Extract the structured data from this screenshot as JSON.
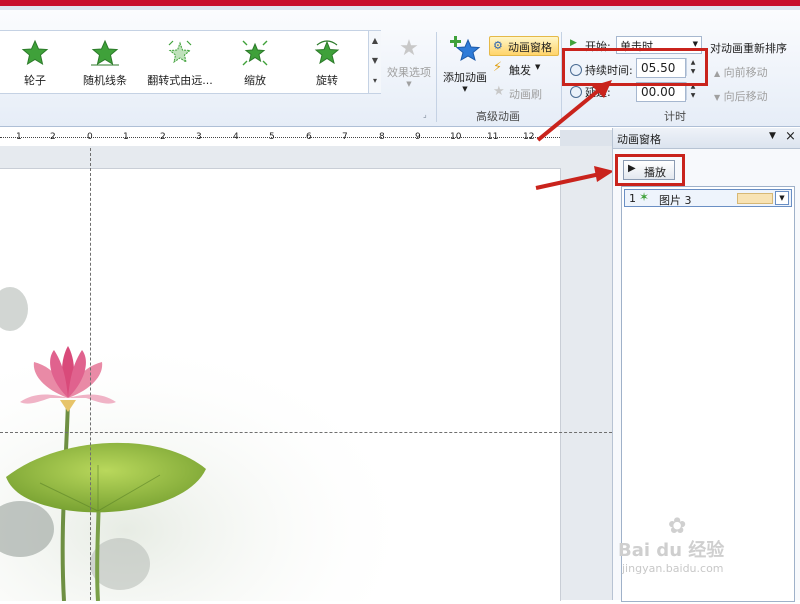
{
  "ribbon": {
    "animations": [
      {
        "label": "轮子",
        "icon": "star-wheel-icon"
      },
      {
        "label": "随机线条",
        "icon": "star-random-lines-icon"
      },
      {
        "label": "翻转式由远...",
        "icon": "star-flip-icon"
      },
      {
        "label": "缩放",
        "icon": "star-zoom-icon"
      },
      {
        "label": "旋转",
        "icon": "star-rotate-icon"
      }
    ],
    "effect_options_label": "效果选项",
    "add_animation_label": "添加动画",
    "animation_pane_btn": "动画窗格",
    "trigger_label": "触发",
    "animation_painter_label": "动画刷",
    "advanced_group_label": "高级动画",
    "start_label": "开始:",
    "start_value": "单击时",
    "duration_label": "持续时间:",
    "duration_value": "05.50",
    "delay_label": "延迟:",
    "delay_value": "00.00",
    "timing_group_label": "计时",
    "reorder_title": "对动画重新排序",
    "move_earlier_label": "向前移动",
    "move_later_label": "向后移动"
  },
  "ruler": {
    "labels": [
      "1",
      "2",
      "1",
      "0",
      "1",
      "2",
      "3",
      "4",
      "5",
      "6",
      "7",
      "8",
      "9",
      "10",
      "11",
      "12"
    ]
  },
  "pane": {
    "title": "动画窗格",
    "play_label": "播放",
    "items": [
      {
        "index": "1",
        "name": "图片 3"
      }
    ]
  },
  "watermark": {
    "brand": "Bai du 经验",
    "url": "jingyan.baidu.com"
  },
  "colors": {
    "highlight_red": "#c9231c",
    "star_green": "#3fa13a",
    "ribbon_blue": "#dbe5f1"
  }
}
